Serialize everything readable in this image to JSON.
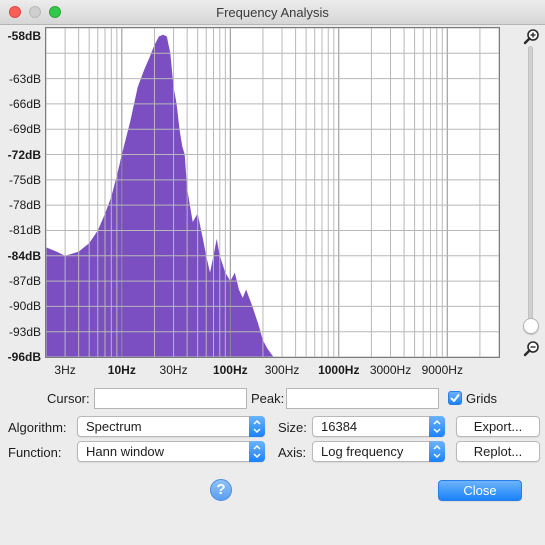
{
  "window": {
    "title": "Frequency Analysis"
  },
  "plot": {
    "y_ticks": [
      {
        "label": "-58dB",
        "value": -58,
        "bold": true
      },
      {
        "label": "-63dB",
        "value": -63
      },
      {
        "label": "-66dB",
        "value": -66
      },
      {
        "label": "-69dB",
        "value": -69
      },
      {
        "label": "-72dB",
        "value": -72,
        "bold": true
      },
      {
        "label": "-75dB",
        "value": -75
      },
      {
        "label": "-78dB",
        "value": -78
      },
      {
        "label": "-81dB",
        "value": -81
      },
      {
        "label": "-84dB",
        "value": -84,
        "bold": true
      },
      {
        "label": "-87dB",
        "value": -87
      },
      {
        "label": "-90dB",
        "value": -90
      },
      {
        "label": "-93dB",
        "value": -93
      },
      {
        "label": "-96dB",
        "value": -96,
        "bold": true
      }
    ],
    "x_ticks": [
      {
        "label": "3Hz",
        "value": 3
      },
      {
        "label": "10Hz",
        "value": 10,
        "bold": true
      },
      {
        "label": "30Hz",
        "value": 30
      },
      {
        "label": "100Hz",
        "value": 100,
        "bold": true
      },
      {
        "label": "300Hz",
        "value": 300
      },
      {
        "label": "1000Hz",
        "value": 1000,
        "bold": true
      },
      {
        "label": "3000Hz",
        "value": 3000
      },
      {
        "label": "9000Hz",
        "value": 9000
      }
    ]
  },
  "chart_data": {
    "type": "area",
    "xscale": "log",
    "xlim": [
      2,
      30000
    ],
    "ylim": [
      -96,
      -57
    ],
    "grid": true,
    "color": "#7b4fc1",
    "x": [
      2,
      2.5,
      3,
      4,
      5,
      6,
      7,
      8,
      9,
      10,
      12,
      14,
      16,
      18,
      20,
      22,
      24,
      26,
      28,
      30,
      32,
      34,
      36,
      38,
      40,
      45,
      50,
      55,
      60,
      65,
      70,
      75,
      80,
      90,
      100,
      110,
      120,
      130,
      140,
      160,
      180,
      200,
      220,
      250,
      280,
      300
    ],
    "y": [
      -83,
      -83.5,
      -84,
      -83.5,
      -82.5,
      -81,
      -79,
      -77,
      -74.5,
      -72,
      -68,
      -64,
      -62,
      -60.5,
      -59,
      -58,
      -57.8,
      -58,
      -60,
      -64,
      -66,
      -69,
      -71,
      -72,
      -76,
      -80,
      -79,
      -81.5,
      -84,
      -86,
      -84,
      -82,
      -84,
      -86,
      -87,
      -86,
      -88,
      -89,
      -88,
      -90,
      -92,
      -94,
      -95,
      -96,
      -96,
      -96
    ]
  },
  "controls": {
    "cursor_label": "Cursor:",
    "cursor_value": "",
    "peak_label": "Peak:",
    "peak_value": "",
    "grids_label": "Grids",
    "grids_checked": true,
    "algorithm_label": "Algorithm:",
    "algorithm_value": "Spectrum",
    "size_label": "Size:",
    "size_value": "16384",
    "function_label": "Function:",
    "function_value": "Hann window",
    "axis_label": "Axis:",
    "axis_value": "Log frequency",
    "export_label": "Export...",
    "replot_label": "Replot...",
    "close_label": "Close",
    "help_label": "?"
  }
}
